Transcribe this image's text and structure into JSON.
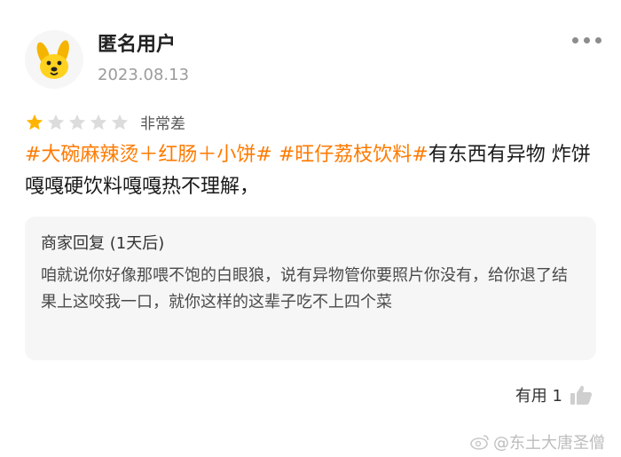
{
  "review": {
    "user": "匿名用户",
    "date": "2023.08.13",
    "rating": 1,
    "rating_max": 5,
    "rating_label": "非常差",
    "tags": [
      "#大碗麻辣烫＋红肠＋小饼#",
      "#旺仔荔枝饮料#"
    ],
    "tag_separator": " ",
    "text": "有东西有异物 炸饼嘎嘎硬饮料嘎嘎热不理解，"
  },
  "merchant_reply": {
    "title": "商家回复 (1天后)",
    "text": "咱就说你好像那喂不饱的白眼狼，说有异物管你要照片你没有，给你退了结果上这咬我一口，就你这样的这辈子吃不上四个菜"
  },
  "useful": {
    "label": "有用 1"
  },
  "watermark": {
    "text": "@东土大唐圣僧"
  },
  "colors": {
    "accent": "#ff7a00",
    "star_filled": "#ffb400",
    "star_empty": "#dcdcdc"
  },
  "icons": [
    "dog-avatar-icon",
    "more-dots-icon",
    "star-icon",
    "thumbs-up-icon",
    "weibo-icon"
  ]
}
